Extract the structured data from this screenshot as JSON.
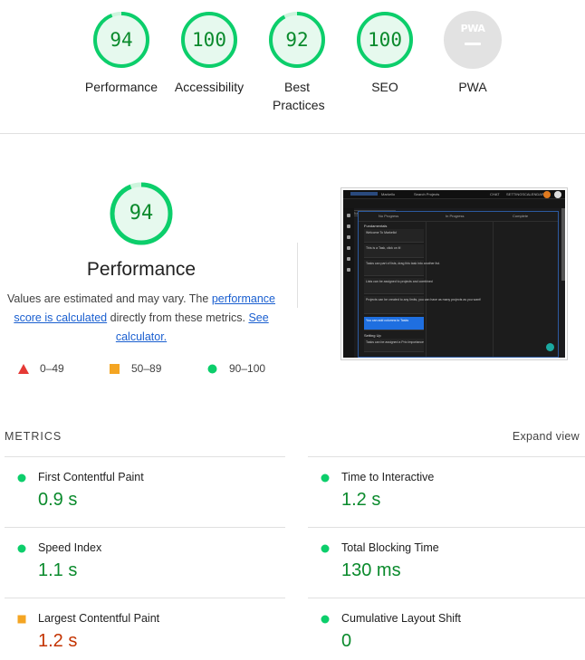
{
  "gauges": [
    {
      "score": "94",
      "label": "Performance",
      "value": 94
    },
    {
      "score": "100",
      "label": "Accessibility",
      "value": 100
    },
    {
      "score": "92",
      "label": "Best Practices",
      "value": 92
    },
    {
      "score": "100",
      "label": "SEO",
      "value": 100
    },
    {
      "score": "",
      "label": "PWA",
      "badge": "PWA"
    }
  ],
  "performance": {
    "score": "94",
    "score_value": 94,
    "title": "Performance",
    "desc_pre": "Values are estimated and may vary. The ",
    "desc_link1": "performance score is calculated",
    "desc_mid": " directly from these metrics. ",
    "desc_link2": "See calculator.",
    "legend": [
      {
        "range": "0–49",
        "shape": "triangle",
        "color": "#e53935"
      },
      {
        "range": "50–89",
        "shape": "square",
        "color": "#f4a523"
      },
      {
        "range": "90–100",
        "shape": "circle",
        "color": "#0cce6b"
      }
    ]
  },
  "thumbnail": {
    "app_name": "Markello",
    "top_links": [
      "Search Projects",
      "CHAT",
      "SETTINGS",
      "CALENDAR"
    ],
    "project": "Tutorial Project",
    "columns": [
      "No Progress",
      "In Progress",
      "Complete"
    ],
    "group1": "Fundamentals",
    "group2": "Setting Up",
    "cards": [
      "Welcome To Markello!",
      "This is a Task, click on it!",
      "Tasks can part of lists, drag this task into another list.",
      "Lists can be assigned to projects and combined",
      "Projects can be created to any limits, you can have as many projects as you want!",
      "You can add columns to Tasks",
      "Tasks can be assigned a Prio Importance"
    ]
  },
  "metrics": {
    "title": "METRICS",
    "expand_label": "Expand view",
    "items": [
      {
        "name": "First Contentful Paint",
        "value": "0.9 s",
        "status": "green"
      },
      {
        "name": "Time to Interactive",
        "value": "1.2 s",
        "status": "green"
      },
      {
        "name": "Speed Index",
        "value": "1.1 s",
        "status": "green"
      },
      {
        "name": "Total Blocking Time",
        "value": "130 ms",
        "status": "green"
      },
      {
        "name": "Largest Contentful Paint",
        "value": "1.2 s",
        "status": "orange"
      },
      {
        "name": "Cumulative Layout Shift",
        "value": "0",
        "status": "green"
      }
    ]
  },
  "colors": {
    "pass": "#0cce6b",
    "pass_text": "#0a8a2c",
    "average": "#f4a523",
    "average_text": "#c33300",
    "fail": "#e53935"
  }
}
